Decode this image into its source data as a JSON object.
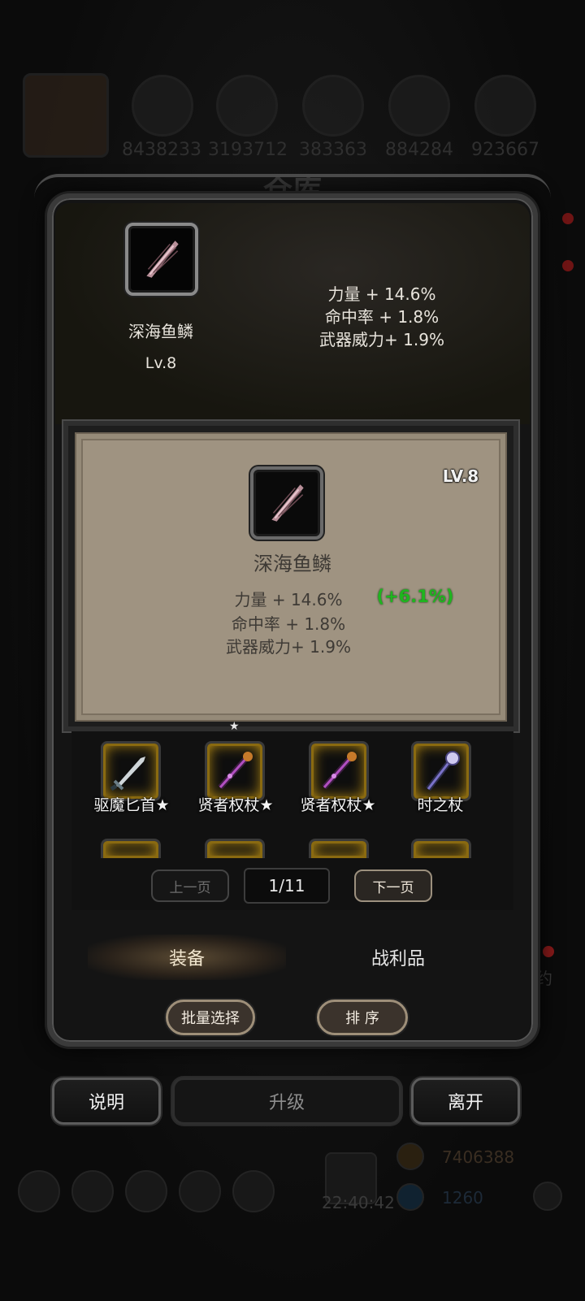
{
  "background": {
    "resource_counts": [
      "8438233",
      "3193712",
      "383363",
      "884284",
      "923667"
    ],
    "title": "仓库",
    "faded_side_text": "约",
    "faded_sort_label": "排序",
    "clock": "22:40:42",
    "gold_count": "7406388",
    "gem_count": "1260"
  },
  "selected_item": {
    "name": "深海鱼鳞",
    "level": "Lv.8",
    "stats": [
      "力量 + 14.6%",
      "命中率 + 1.8%",
      "武器威力+ 1.9%"
    ]
  },
  "detail_card": {
    "level": "LV.8",
    "name": "深海鱼鳞",
    "stats": [
      "力量 + 14.6%",
      "命中率 + 1.8%",
      "武器威力+ 1.9%"
    ],
    "bonus": "(+6.1%)",
    "bonus_color": "#1fb51f"
  },
  "inventory": {
    "items": [
      {
        "name": "驱魔匕首★",
        "icon": "dagger-icon"
      },
      {
        "name": "贤者权杖★",
        "icon": "scepter-icon"
      },
      {
        "name": "贤者权杖★",
        "icon": "scepter-icon"
      },
      {
        "name": "时之杖",
        "icon": "staff-icon"
      }
    ]
  },
  "pager": {
    "prev_label": "上一页",
    "page": "1/11",
    "next_label": "下一页"
  },
  "tabs": {
    "equip": "装备",
    "loot": "战利品"
  },
  "actions": {
    "batch_select": "批量选择",
    "sort": "排 序",
    "help": "说明",
    "upgrade": "升级",
    "leave": "离开"
  }
}
